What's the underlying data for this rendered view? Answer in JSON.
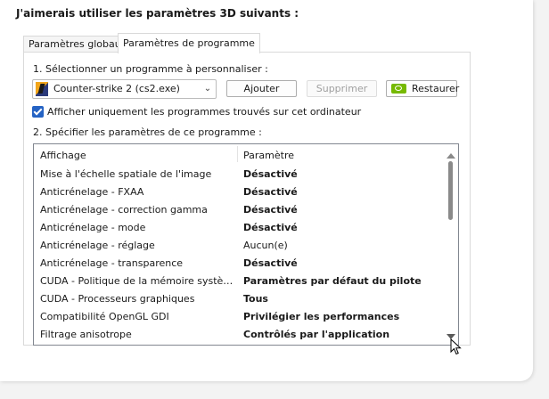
{
  "heading": "J'aimerais utiliser les paramètres 3D suivants :",
  "tabs": [
    {
      "label": "Paramètres globaux",
      "active": false
    },
    {
      "label": "Paramètres de programme",
      "active": true
    }
  ],
  "step1_label": "1. Sélectionner un programme à personnaliser :",
  "program_select": {
    "value": "Counter-strike 2 (cs2.exe)",
    "icon": "cs2-app-icon"
  },
  "buttons": {
    "add": "Ajouter",
    "remove": "Supprimer",
    "restore": "Restaurer"
  },
  "checkbox": {
    "label": "Afficher uniquement les programmes trouvés sur cet ordinateur",
    "checked": true
  },
  "step2_label": "2. Spécifier les paramètres de ce programme :",
  "settings_table": {
    "columns": [
      "Affichage",
      "Paramètre"
    ],
    "rows": [
      {
        "name": "Mise à l'échelle spatiale de l'image",
        "value": "Désactivé",
        "bold": true
      },
      {
        "name": "Anticrénelage - FXAA",
        "value": "Désactivé",
        "bold": true
      },
      {
        "name": "Anticrénelage - correction gamma",
        "value": "Désactivé",
        "bold": true
      },
      {
        "name": "Anticrénelage - mode",
        "value": "Désactivé",
        "bold": true
      },
      {
        "name": "Anticrénelage - réglage",
        "value": "Aucun(e)",
        "bold": false
      },
      {
        "name": "Anticrénelage - transparence",
        "value": "Désactivé",
        "bold": true
      },
      {
        "name": "CUDA - Politique de la mémoire système de secours",
        "value": "Paramètres par défaut du pilote",
        "bold": true
      },
      {
        "name": "CUDA - Processeurs graphiques",
        "value": "Tous",
        "bold": true
      },
      {
        "name": "Compatibilité OpenGL GDI",
        "value": "Privilégier les performances",
        "bold": true
      },
      {
        "name": "Filtrage anisotrope",
        "value": "Contrôlés par l'application",
        "bold": true
      }
    ]
  },
  "colors": {
    "checkbox_accent": "#2563c4",
    "nvidia_green": "#76b900",
    "disabled_text": "#a0a0a0"
  }
}
